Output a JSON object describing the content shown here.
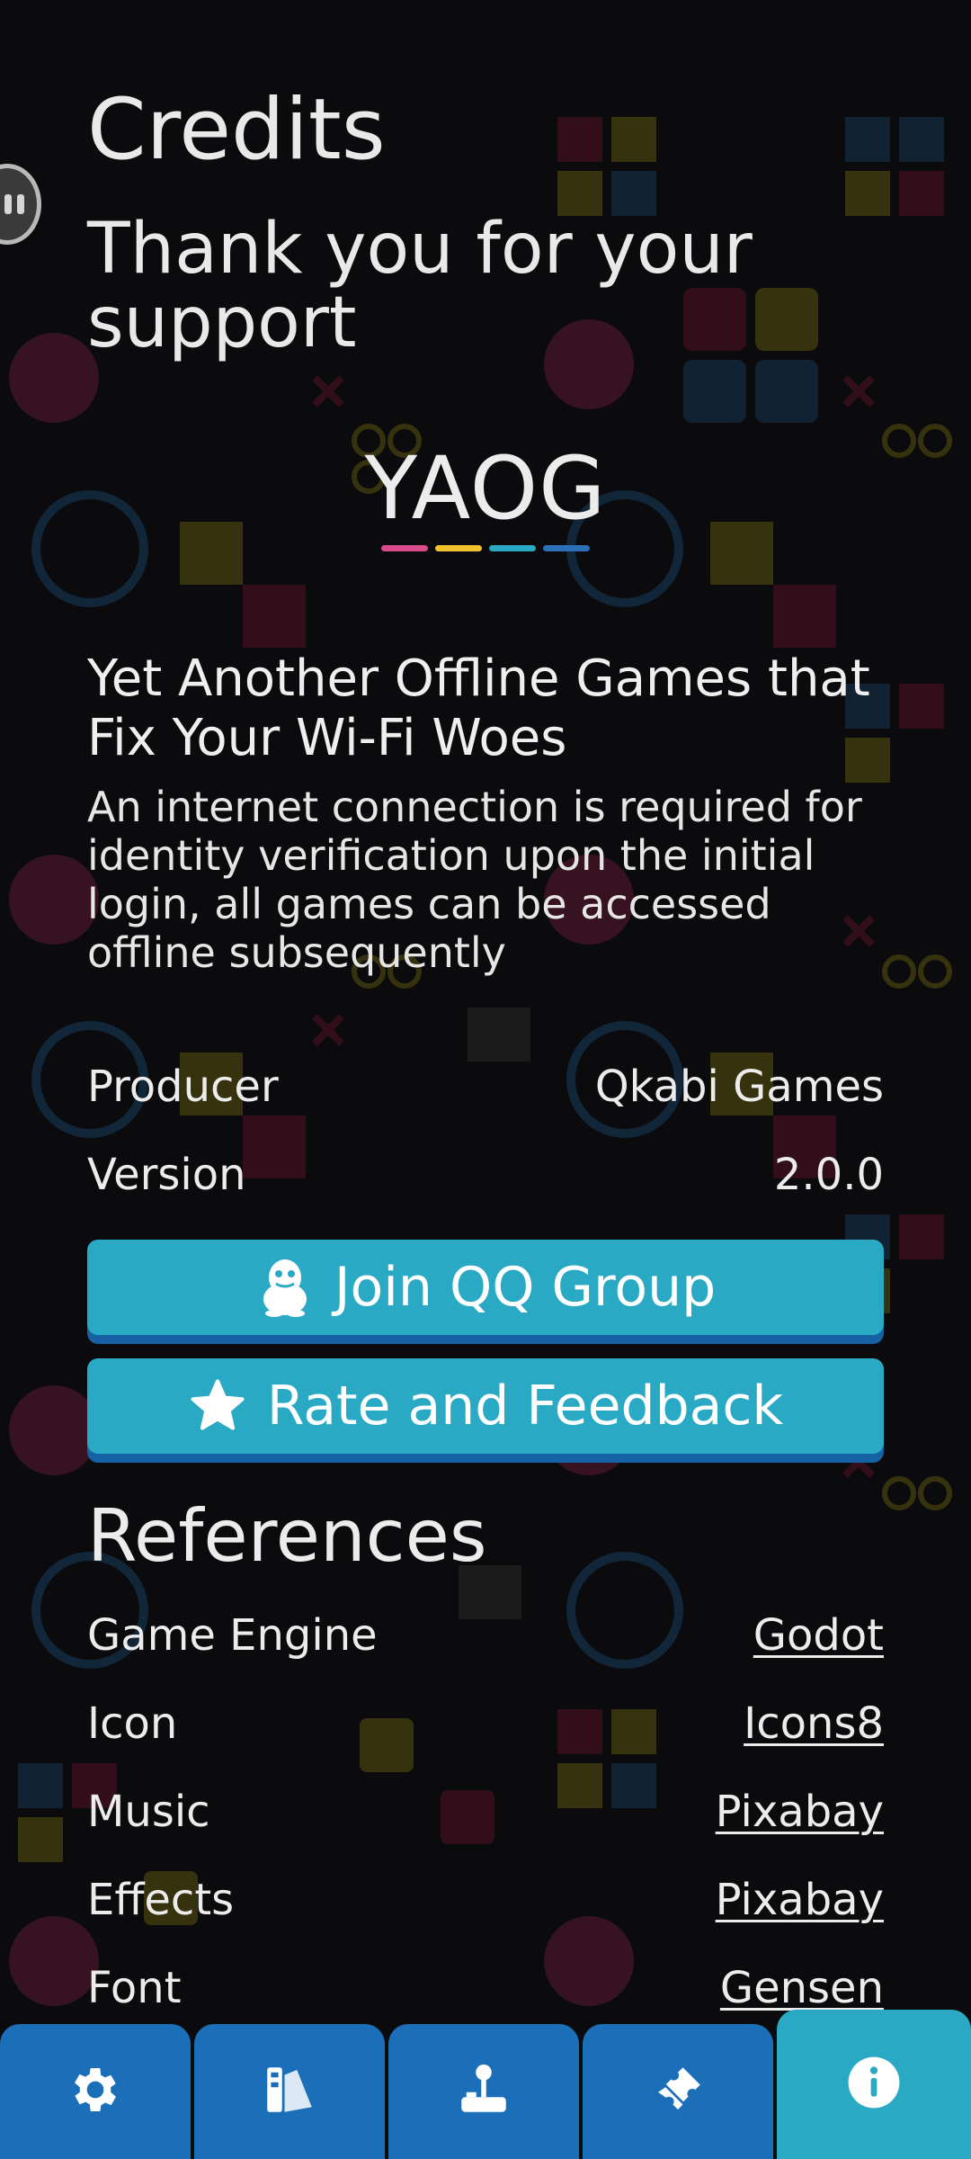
{
  "header": {
    "title": "Credits",
    "subtitle": "Thank you for your support"
  },
  "logo": {
    "text": "YAOG",
    "bar_colors": [
      "#d94b8a",
      "#f2c12e",
      "#2aa9c4",
      "#2a6fb8"
    ]
  },
  "about": {
    "tagline": "Yet Another Offline Games that Fix Your Wi-Fi Woes",
    "note": "An internet connection is required for identity verification upon the initial login, all games can be accessed offline subsequently"
  },
  "info": {
    "producer_label": "Producer",
    "producer_value": "Qkabi Games",
    "version_label": "Version",
    "version_value": "2.0.0"
  },
  "buttons": {
    "join_qq": "Join QQ Group",
    "rate": "Rate and Feedback"
  },
  "references": {
    "title": "References",
    "items": [
      {
        "label": "Game Engine",
        "value": "Godot"
      },
      {
        "label": "Icon",
        "value": "Icons8"
      },
      {
        "label": "Music",
        "value": "Pixabay"
      },
      {
        "label": "Effects",
        "value": "Pixabay"
      },
      {
        "label": "Font",
        "value": "Gensen"
      }
    ]
  },
  "nav": {
    "tabs": [
      {
        "icon": "gear-icon"
      },
      {
        "icon": "palette-icon"
      },
      {
        "icon": "joystick-icon"
      },
      {
        "icon": "ticket-icon"
      },
      {
        "icon": "info-icon",
        "active": true
      }
    ]
  },
  "colors": {
    "button": "#2aa9c4",
    "button_shadow": "#1561a3",
    "nav": "#1a6fb8",
    "nav_active": "#2aa9c4"
  }
}
